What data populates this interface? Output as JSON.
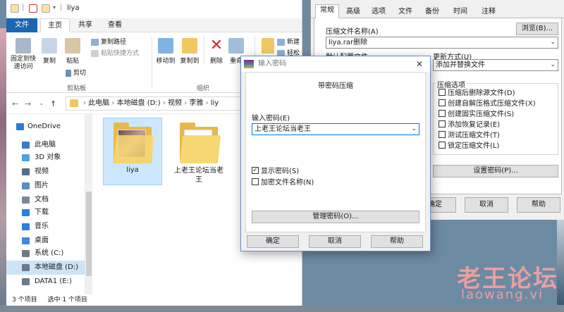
{
  "explorer": {
    "window_title": "liya",
    "tabs": [
      "文件",
      "主页",
      "共享",
      "查看"
    ],
    "ribbon": {
      "pin_label": "固定到快速访问",
      "copy_label": "复制",
      "paste_label": "粘贴",
      "copy_path_label": "复制路径",
      "paste_shortcut_label": "粘贴快捷方式",
      "cut_label": "剪切",
      "clipboard_group": "剪贴板",
      "move_to_label": "移动到",
      "copy_to_label": "复制到",
      "delete_label": "删除",
      "rename_label": "重命",
      "organize_group": "组织",
      "new_label": "新建",
      "easy_label": "轻松"
    },
    "breadcrumb": [
      "此电脑",
      "本地磁盘 (D:)",
      "视频",
      "李雅",
      "liy"
    ],
    "nav_items": [
      {
        "label": "OneDrive",
        "color": "#2b7cd3"
      },
      {
        "label": "此电脑",
        "color": "#3a7bc8"
      },
      {
        "label": "3D 对象",
        "color": "#4aa3df"
      },
      {
        "label": "视频",
        "color": "#5a6d86"
      },
      {
        "label": "图片",
        "color": "#5a8fc6"
      },
      {
        "label": "文档",
        "color": "#7d8894"
      },
      {
        "label": "下载",
        "color": "#2f7fd8"
      },
      {
        "label": "音乐",
        "color": "#2f7fd8"
      },
      {
        "label": "桌面",
        "color": "#3c8be0"
      },
      {
        "label": "系统 (C:)",
        "color": "#6b7a88"
      },
      {
        "label": "本地磁盘 (D:)",
        "color": "#6b7a88"
      },
      {
        "label": "DATA1 (E:)",
        "color": "#6b7a88"
      }
    ],
    "files": [
      {
        "name": "liya"
      },
      {
        "name": "上老王论坛当老王"
      }
    ],
    "status_count": "3 个项目",
    "status_selected": "选中 1 个项目"
  },
  "options": {
    "tabs": [
      "常规",
      "高级",
      "选项",
      "文件",
      "备份",
      "时间",
      "注释"
    ],
    "archive_name_label": "压缩文件名称(A)",
    "browse_label": "浏览(B)...",
    "archive_name_value": "liya.rar删除",
    "default_profile_label": "默认配置文件",
    "update_mode_label": "更新方式(U)",
    "update_mode_value": "添加并替换文件",
    "compress_options_title": "压缩选项",
    "checks": [
      {
        "label": "压缩后删除源文件(D)",
        "checked": false
      },
      {
        "label": "创建自解压格式压缩文件(X)",
        "checked": false
      },
      {
        "label": "创建固实压缩文件(S)",
        "checked": false
      },
      {
        "label": "添加恢复记录(E)",
        "checked": false
      },
      {
        "label": "测试压缩文件(T)",
        "checked": false
      },
      {
        "label": "锁定压缩文件(L)",
        "checked": false
      }
    ],
    "set_password_label": "设置密码(P)...",
    "ok_label": "确定",
    "cancel_label": "取消",
    "help_label": "帮助"
  },
  "password_dialog": {
    "title": "输入密码",
    "heading": "带密码压缩",
    "enter_label": "输入密码(E)",
    "password_value": "上老王论坛当老王",
    "show_password_label": "显示密码(S)",
    "show_password_checked": true,
    "encrypt_names_label": "加密文件名称(N)",
    "encrypt_names_checked": false,
    "manage_label": "管理密码(O)...",
    "ok_label": "确定",
    "cancel_label": "取消",
    "help_label": "帮助"
  },
  "watermark": {
    "line1": "老王论坛",
    "line2": "laowang.vi"
  }
}
